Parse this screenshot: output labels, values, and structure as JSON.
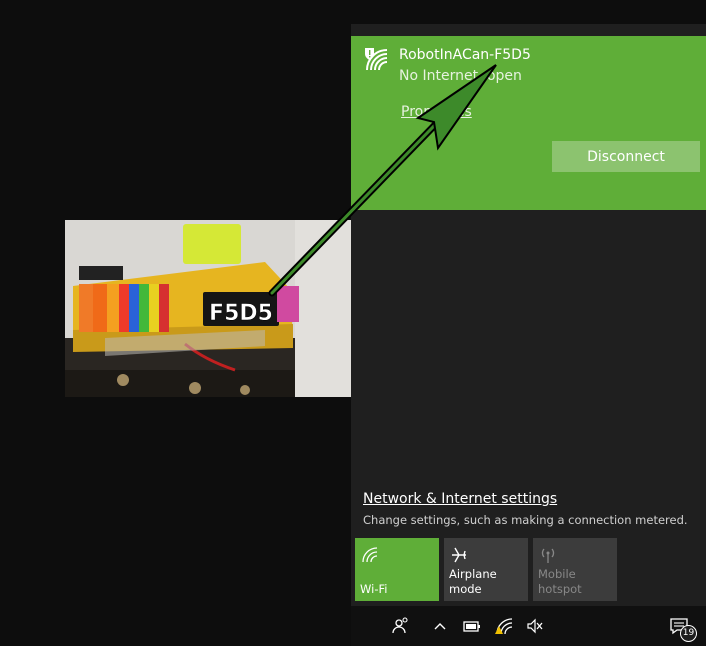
{
  "network": {
    "name": "RobotInACan-F5D5",
    "status": "No Internet, open",
    "properties_label": "Properties",
    "disconnect_label": "Disconnect"
  },
  "settings": {
    "link_label": "Network & Internet settings",
    "description": "Change settings, such as making a connection metered."
  },
  "quick_actions": [
    {
      "label": "Wi-Fi",
      "icon": "wifi-icon",
      "active": true
    },
    {
      "label": "Airplane mode",
      "icon": "airplane-icon",
      "active": false
    },
    {
      "label": "Mobile\nhotspot",
      "icon": "hotspot-icon",
      "active": false
    }
  ],
  "taskbar": {
    "notification_count": "19",
    "icons": [
      "people-icon",
      "chevron-up-icon",
      "battery-icon",
      "wifi-warning-icon",
      "volume-muted-icon",
      "action-center-icon"
    ]
  },
  "photo": {
    "label_text": "F5D5"
  },
  "colors": {
    "accent": "#5fae38",
    "flyout_bg": "#1f1f1f",
    "tile_inactive": "#3c3c3c",
    "arrow": "#1a5a14"
  }
}
